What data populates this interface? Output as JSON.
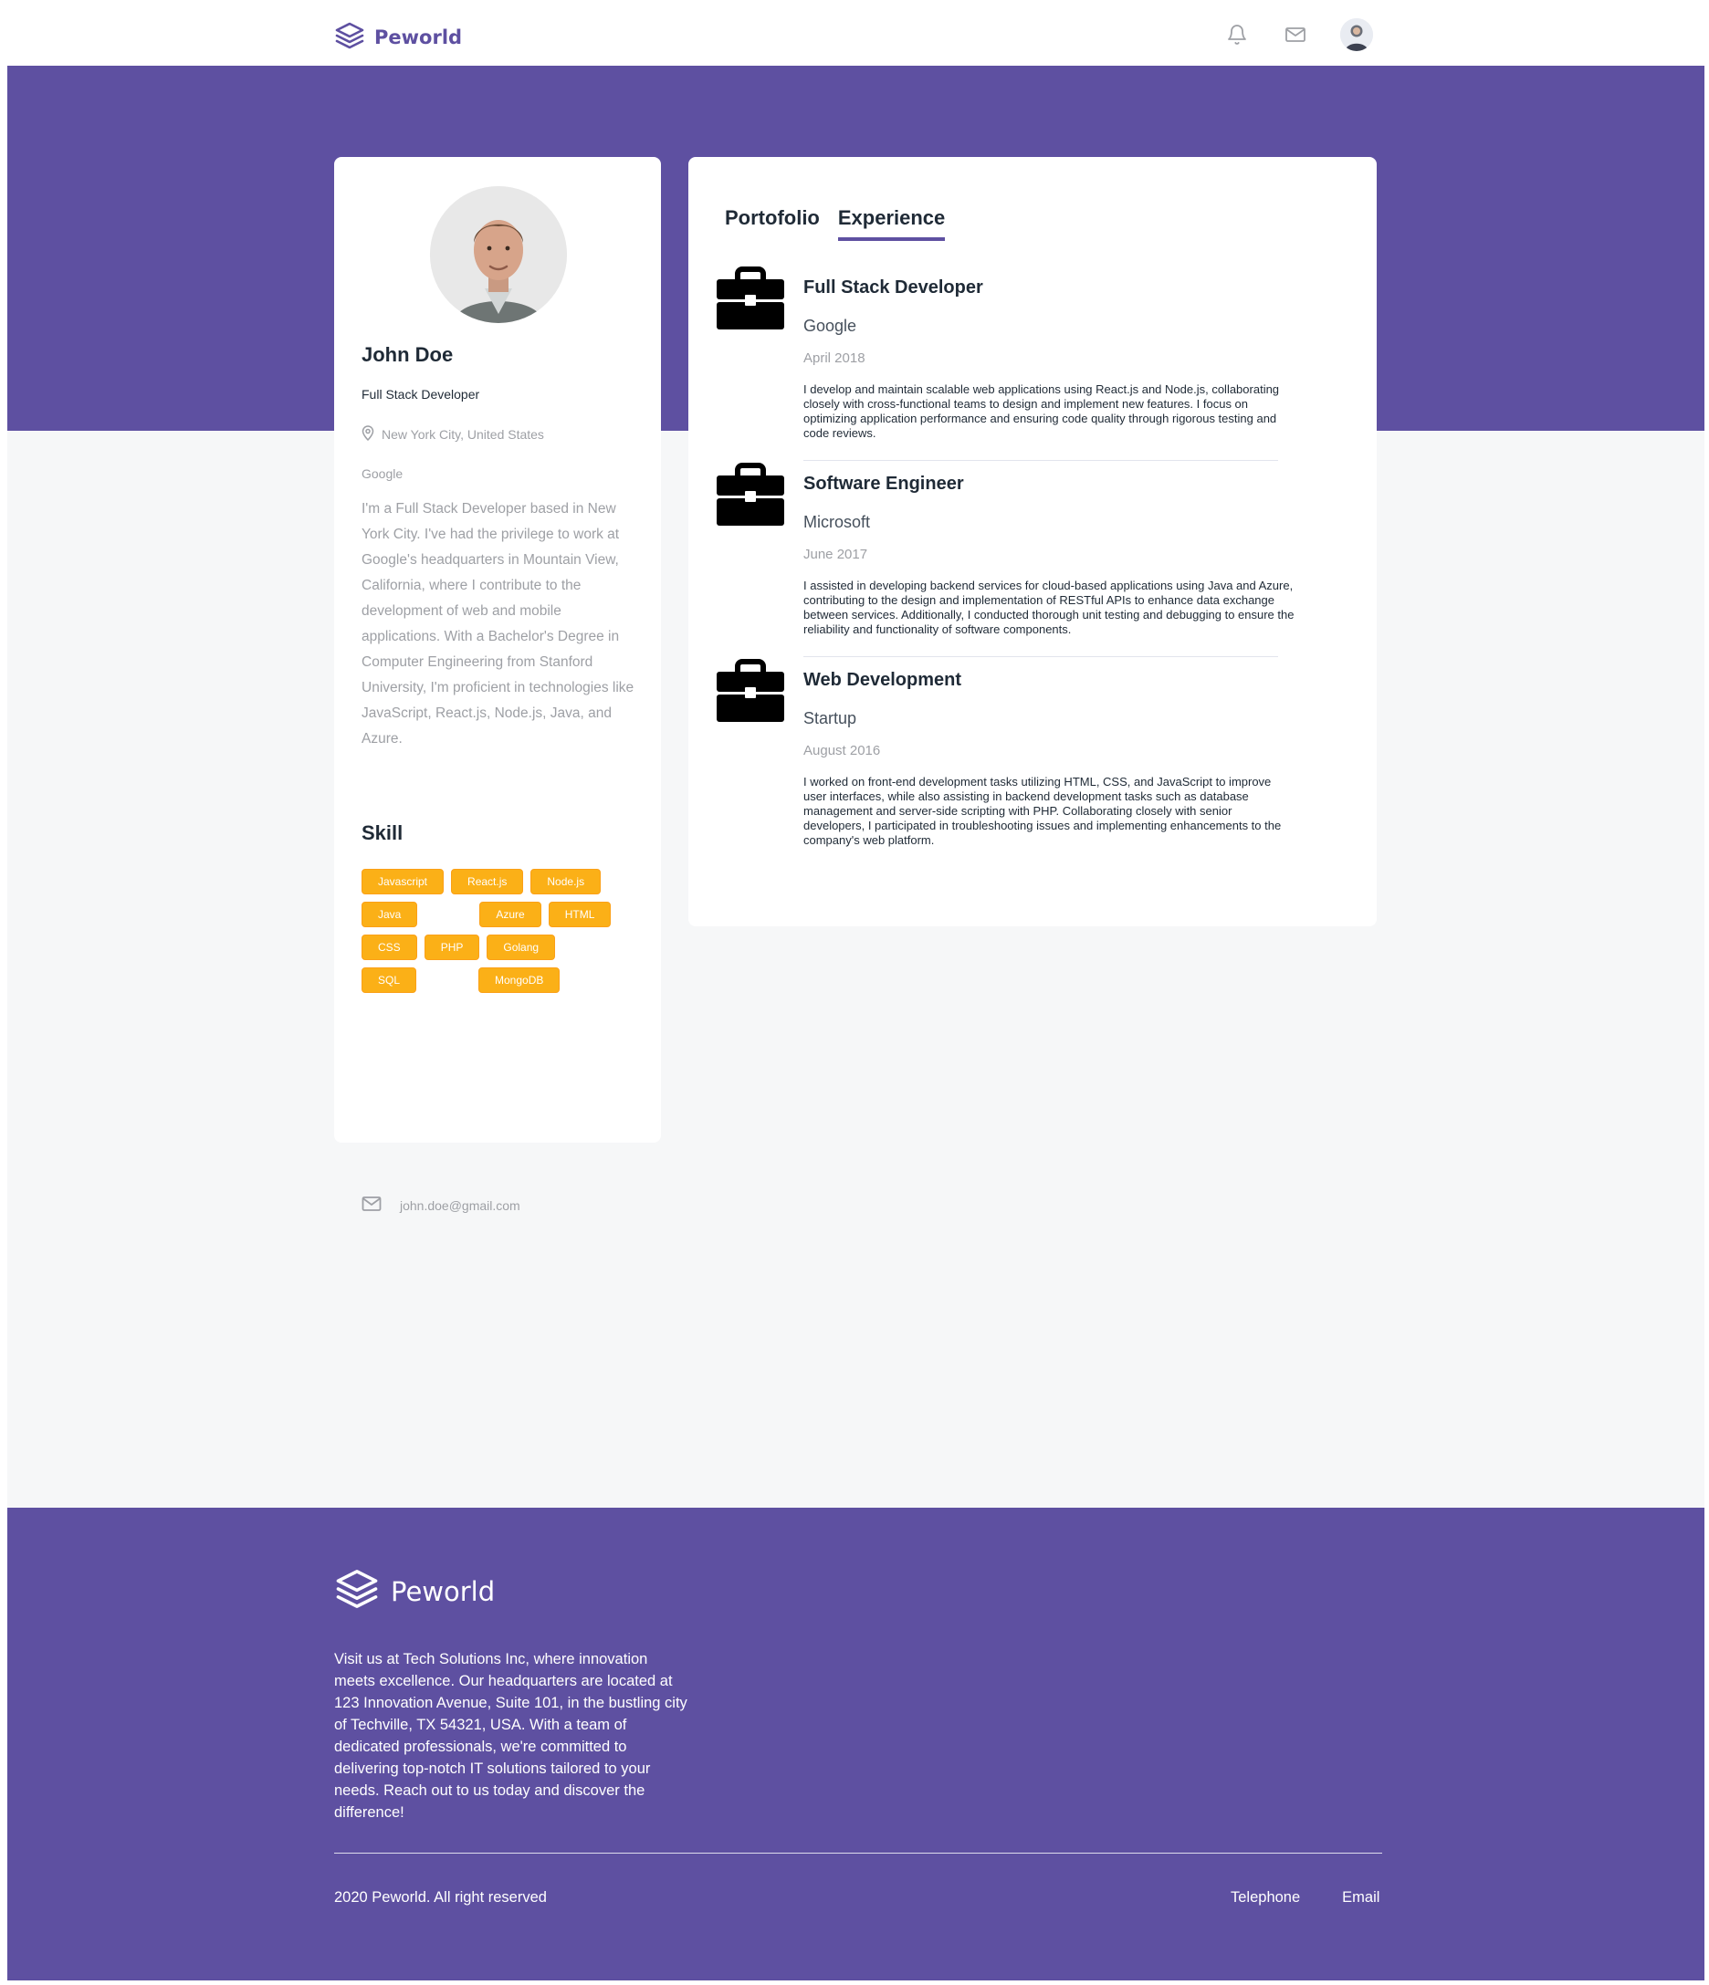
{
  "navbar": {
    "brand": "Peworld",
    "brand_icon": "layers-icon",
    "icons": [
      "bell-icon",
      "mail-icon",
      "avatar"
    ]
  },
  "profile": {
    "name": "John Doe",
    "role": "Full Stack Developer",
    "location": "New York City, United States",
    "company": "Google",
    "about": "I'm a Full Stack Developer based in New York City. I've had the privilege to work at Google's headquarters in Mountain View, California, where I contribute to the development of web and mobile applications. With a Bachelor's Degree in Computer Engineering from Stanford University, I'm proficient in technologies like JavaScript, React.js, Node.js, Java, and Azure.",
    "skill_title": "Skill",
    "skills": [
      "Javascript",
      "React.js",
      "Node.js",
      "Java",
      "Azure",
      "HTML",
      "CSS",
      "PHP",
      "Golang",
      "SQL",
      "MongoDB"
    ],
    "email": "john.doe@gmail.com"
  },
  "tabs": {
    "portfolio": "Portofolio",
    "experience": "Experience",
    "active": "experience"
  },
  "experiences": [
    {
      "title": "Full Stack Developer",
      "company": "Google",
      "date": "April 2018",
      "description": "I develop and maintain scalable web applications using React.js and Node.js, collaborating closely with cross-functional teams to design and implement new features. I focus on optimizing application performance and ensuring code quality through rigorous testing and code reviews."
    },
    {
      "title": "Software Engineer",
      "company": "Microsoft",
      "date": "June 2017",
      "description": "I assisted in developing backend services for cloud-based applications using Java and Azure, contributing to the design and implementation of RESTful APIs to enhance data exchange between services. Additionally, I conducted thorough unit testing and debugging to ensure the reliability and functionality of software components."
    },
    {
      "title": "Web Development",
      "company": "Startup",
      "date": "August 2016",
      "description": "I worked on front-end development tasks utilizing HTML, CSS, and JavaScript to improve user interfaces, while also assisting in backend development tasks such as database management and server-side scripting with PHP. Collaborating closely with senior developers, I participated in troubleshooting issues and implementing enhancements to the company's web platform."
    }
  ],
  "footer": {
    "brand": "Peworld",
    "description": "Visit us at Tech Solutions Inc, where innovation meets excellence. Our headquarters are located at 123 Innovation Avenue, Suite 101, in the bustling city of Techville, TX 54321, USA. With a team of dedicated professionals, we're committed to delivering top-notch IT solutions tailored to your needs. Reach out to us today and discover the difference!",
    "copyright": "2020 Peworld. All right reserved",
    "links": [
      "Telephone",
      "Email"
    ]
  },
  "colors": {
    "primary": "#5E50A1",
    "skill_bg": "#FBB017",
    "page_bg": "#F6F7F8",
    "text_dark": "#1F2A36",
    "text_muted": "#9EA0A5"
  }
}
